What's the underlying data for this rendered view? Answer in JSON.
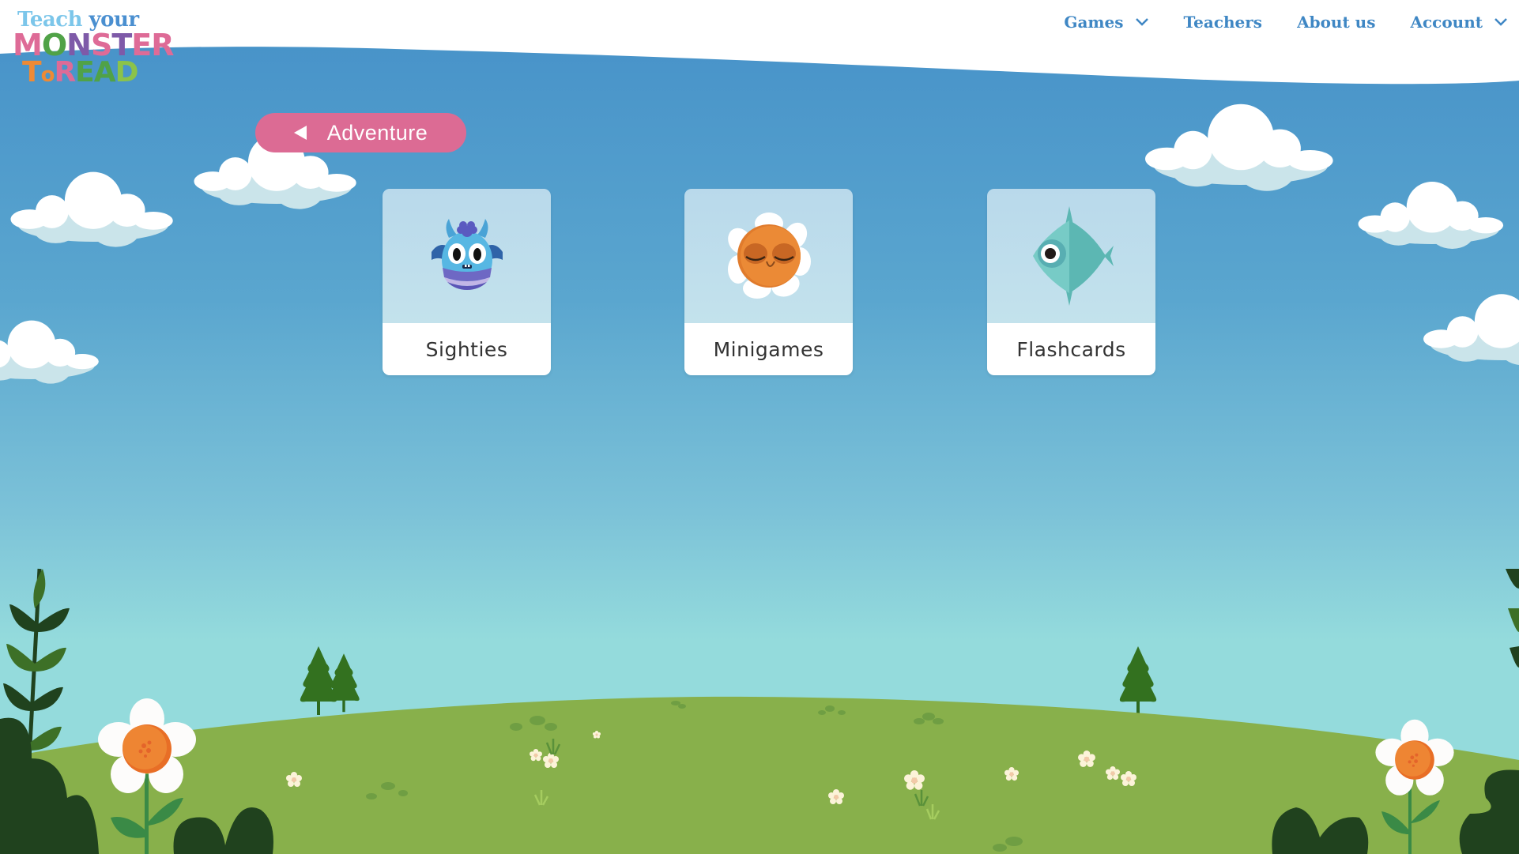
{
  "logo": {
    "line1_part1": "Teach ",
    "line1_part2": "your",
    "line2": "MONSTER",
    "line3": "TOREAD",
    "alt": "Teach your Monster to Read"
  },
  "nav": {
    "items": [
      {
        "label": "Games",
        "has_dropdown": true
      },
      {
        "label": "Teachers",
        "has_dropdown": false
      },
      {
        "label": "About us",
        "has_dropdown": false
      },
      {
        "label": "Account",
        "has_dropdown": true
      }
    ]
  },
  "back_button": {
    "label": "Adventure",
    "icon": "back-triangle-icon"
  },
  "cards": [
    {
      "label": "Sighties",
      "icon": "blue-monster-icon"
    },
    {
      "label": "Minigames",
      "icon": "sunflower-face-icon"
    },
    {
      "label": "Flashcards",
      "icon": "fish-icon"
    }
  ],
  "colors": {
    "nav_text": "#3f87c4",
    "button_pink": "#dc6b94",
    "sky_top": "#4590c8",
    "sky_bottom": "#94dbdc",
    "grass": "#88b04b",
    "dark_leaf": "#20421e"
  }
}
